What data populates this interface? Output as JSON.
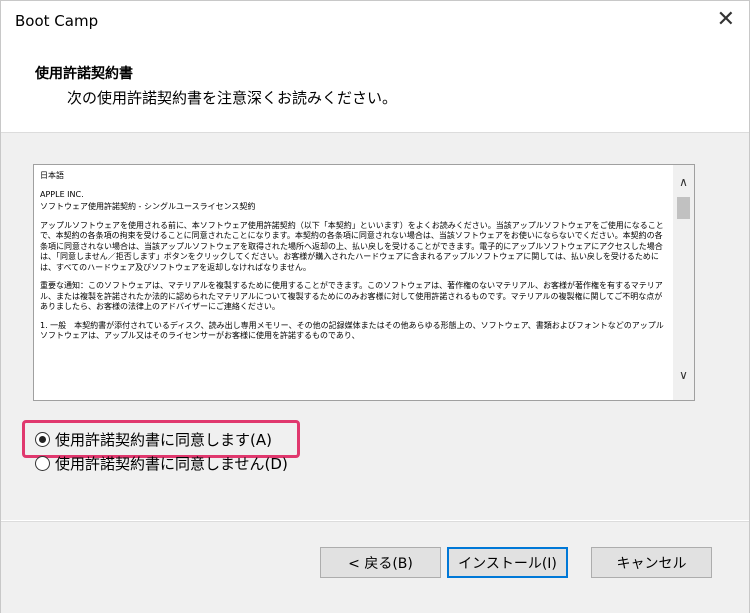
{
  "window": {
    "title": "Boot Camp"
  },
  "header": {
    "title": "使用許諾契約書",
    "subtitle": "次の使用許諾契約書を注意深くお読みください。"
  },
  "license": {
    "lines": [
      "日本語",
      "APPLE INC.",
      "ソフトウェア使用許諾契約 - シングルユースライセンス契約",
      "アップルソフトウェアを使用される前に、本ソフトウェア使用許諾契約（以下「本契約」といいます）をよくお読みください。当該アップルソフトウェアをご使用になることで、本契約の各条項の拘束を受けることに同意されたことになります。本契約の各条項に同意されない場合は、当該ソフトウェアをお使いにならないでください。本契約の各条項に同意されない場合は、当該アップルソフトウェアを取得された場所へ返却の上、払い戻しを受けることができます。電子的にアップルソフトウェアにアクセスした場合は、「同意しません／拒否します」ボタンをクリックしてください。お客様が購入されたハードウェアに含まれるアップルソフトウェアに関しては、払い戻しを受けるためには、すべてのハードウェア及びソフトウェアを返却しなければなりません。",
      "重要な通知：このソフトウェアは、マテリアルを複製するために使用することができます。このソフトウェアは、著作権のないマテリアル、お客様が著作権を有するマテリアル、または複製を許諾されたか法的に認められたマテリアルについて複製するためにのみお客様に対して使用許諾されるものです。マテリアルの複製権に関してご不明な点がありましたら、お客様の法律上のアドバイザーにご連絡ください。",
      "1. 一般　本契約書が添付されているディスク、読み出し専用メモリー、その他の記録媒体またはその他あらゆる形態上の、ソフトウェア、書類およびフォントなどのアップルソフトウェアは、アップル又はそのライセンサーがお客様に使用を許諾するものであり、"
    ]
  },
  "options": {
    "accept": "使用許諾契約書に同意します(A)",
    "decline": "使用許諾契約書に同意しません(D)",
    "selected": "accept"
  },
  "buttons": {
    "back": "< 戻る(B)",
    "install": "インストール(I)",
    "cancel": "キャンセル"
  }
}
